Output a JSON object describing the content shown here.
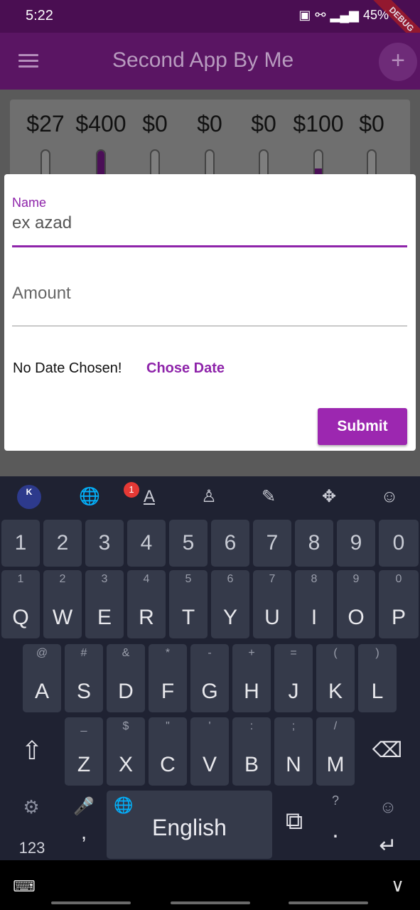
{
  "status": {
    "time": "5:22",
    "battery": "45%",
    "debug": "DEBUG"
  },
  "appbar": {
    "title": "Second App By Me",
    "add": "+"
  },
  "chart": {
    "amounts": [
      "$27",
      "$400",
      "$0",
      "$0",
      "$0",
      "$100",
      "$0"
    ]
  },
  "chart_data": {
    "type": "bar",
    "values": [
      27,
      400,
      0,
      0,
      0,
      100,
      0
    ],
    "labels": [
      "$27",
      "$400",
      "$0",
      "$0",
      "$0",
      "$100",
      "$0"
    ]
  },
  "form": {
    "name_label": "Name",
    "name_value": "ex azad",
    "amount_placeholder": "Amount",
    "date_text": "No Date Chosen!",
    "chose_date": "Chose Date",
    "submit": "Submit"
  },
  "keyboard": {
    "numbers": [
      "1",
      "2",
      "3",
      "4",
      "5",
      "6",
      "7",
      "8",
      "9",
      "0"
    ],
    "row1": {
      "main": [
        "Q",
        "W",
        "E",
        "R",
        "T",
        "Y",
        "U",
        "I",
        "O",
        "P"
      ],
      "sub": [
        "1",
        "2",
        "3",
        "4",
        "5",
        "6",
        "7",
        "8",
        "9",
        "0"
      ]
    },
    "row2": {
      "main": [
        "A",
        "S",
        "D",
        "F",
        "G",
        "H",
        "J",
        "K",
        "L"
      ],
      "sub": [
        "@",
        "#",
        "&",
        "*",
        "-",
        "+",
        "=",
        "(",
        ")"
      ]
    },
    "row3": {
      "main": [
        "Z",
        "X",
        "C",
        "V",
        "B",
        "N",
        "M"
      ],
      "sub": [
        "_",
        "$",
        "\"",
        "'",
        ":",
        ";",
        "/"
      ]
    },
    "logo": "K",
    "badge": "1",
    "mode_key": "123",
    "comma": ",",
    "space_label": "English",
    "period": ".",
    "question": "?"
  }
}
